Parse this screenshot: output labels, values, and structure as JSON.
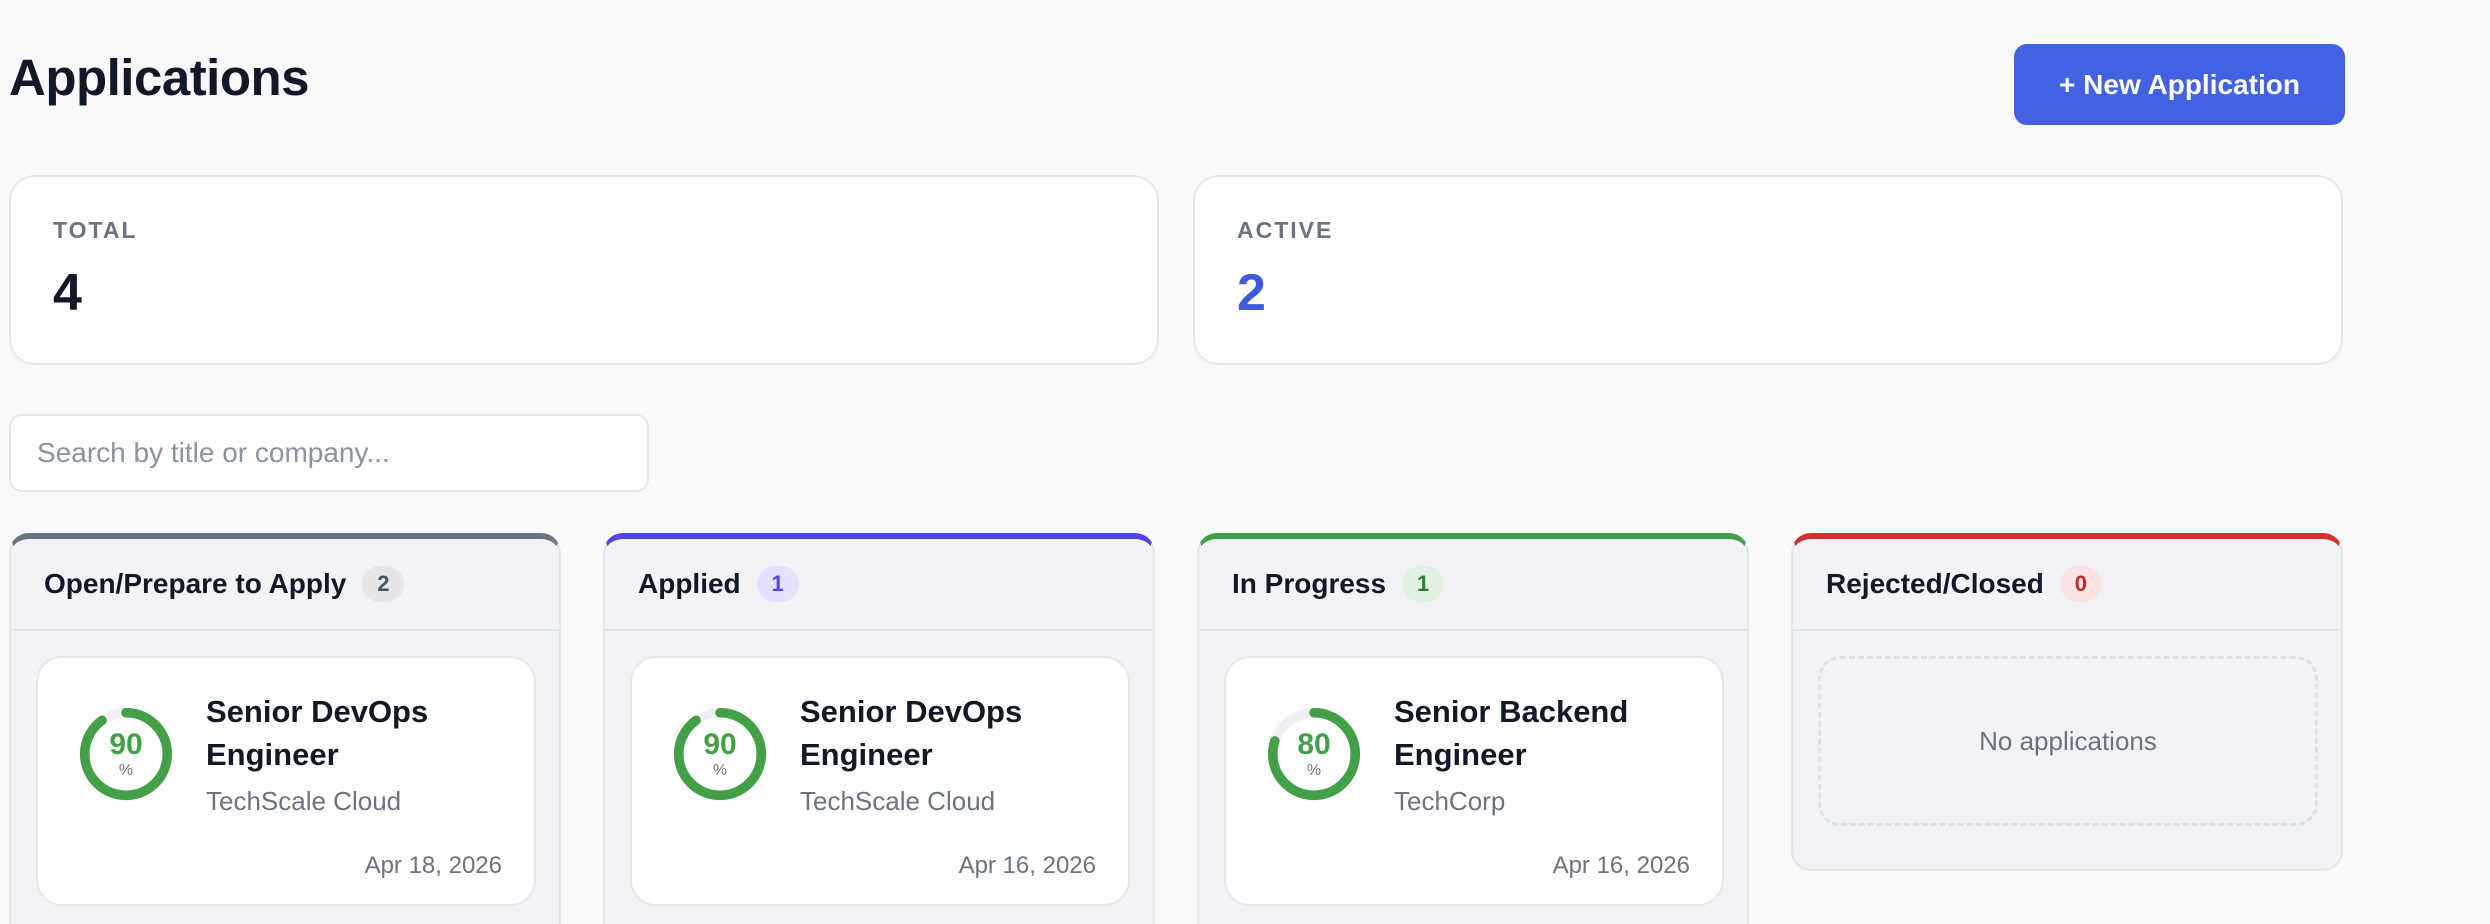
{
  "header": {
    "title": "Applications",
    "new_button_label": "+ New Application"
  },
  "stats": {
    "total": {
      "label": "TOTAL",
      "value": "4"
    },
    "active": {
      "label": "ACTIVE",
      "value": "2"
    }
  },
  "search": {
    "placeholder": "Search by title or company...",
    "value": ""
  },
  "colors": {
    "accent": "#4262e3",
    "open": "#6b7280",
    "applied": "#4f46e5",
    "in_progress": "#43a047",
    "rejected": "#d32f2f"
  },
  "columns": [
    {
      "title": "Open/Prepare to Apply",
      "count": "2",
      "cards": [
        {
          "score": 90,
          "unit": "%",
          "title": "Senior DevOps Engineer",
          "company": "TechScale Cloud",
          "date": "Apr 18, 2026"
        }
      ]
    },
    {
      "title": "Applied",
      "count": "1",
      "cards": [
        {
          "score": 90,
          "unit": "%",
          "title": "Senior DevOps Engineer",
          "company": "TechScale Cloud",
          "date": "Apr 16, 2026"
        }
      ]
    },
    {
      "title": "In Progress",
      "count": "1",
      "cards": [
        {
          "score": 80,
          "unit": "%",
          "title": "Senior Backend Engineer",
          "company": "TechCorp",
          "date": "Apr 16, 2026"
        }
      ]
    },
    {
      "title": "Rejected/Closed",
      "count": "0",
      "empty_text": "No applications"
    }
  ]
}
